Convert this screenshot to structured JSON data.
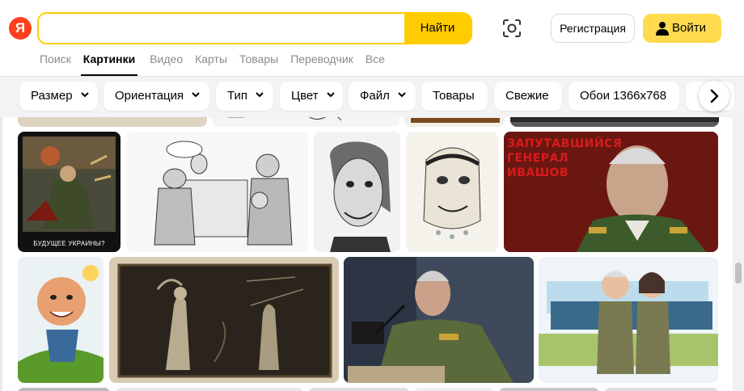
{
  "header": {
    "logo_letter": "Я",
    "search": {
      "value": "",
      "button_label": "Найти"
    },
    "register_label": "Регистрация",
    "login_label": "Войти",
    "tabs": [
      {
        "label": "Поиск",
        "active": false
      },
      {
        "label": "Картинки",
        "active": true
      },
      {
        "label": "Видео",
        "active": false
      },
      {
        "label": "Карты",
        "active": false
      },
      {
        "label": "Товары",
        "active": false
      },
      {
        "label": "Переводчик",
        "active": false
      },
      {
        "label": "Все",
        "active": false
      }
    ]
  },
  "filters": [
    {
      "label": "Размер",
      "dropdown": true
    },
    {
      "label": "Ориентация",
      "dropdown": true
    },
    {
      "label": "Тип",
      "dropdown": true
    },
    {
      "label": "Цвет",
      "dropdown": true
    },
    {
      "label": "Файл",
      "dropdown": true
    },
    {
      "label": "Товары",
      "dropdown": false
    },
    {
      "label": "Свежие",
      "dropdown": false
    },
    {
      "label": "Обои 1366x768",
      "dropdown": false
    }
  ],
  "results": {
    "captions": {
      "poster": "БУДУЩЕЕ УКРАИНЫ?",
      "general_lines": [
        "ЗАПУТАВШИЙСЯ",
        "ГЕНЕРАЛ",
        "ИВАШОВ"
      ]
    }
  },
  "colors": {
    "accent": "#ffcc00",
    "login_bg": "#ffdb4d",
    "logo_red": "#fc3f1d",
    "filter_bar_bg": "#f3f3f5"
  },
  "icons": [
    "yandex-logo-icon",
    "camera-lens-icon",
    "user-icon",
    "chevron-down-icon",
    "chevron-right-icon"
  ]
}
